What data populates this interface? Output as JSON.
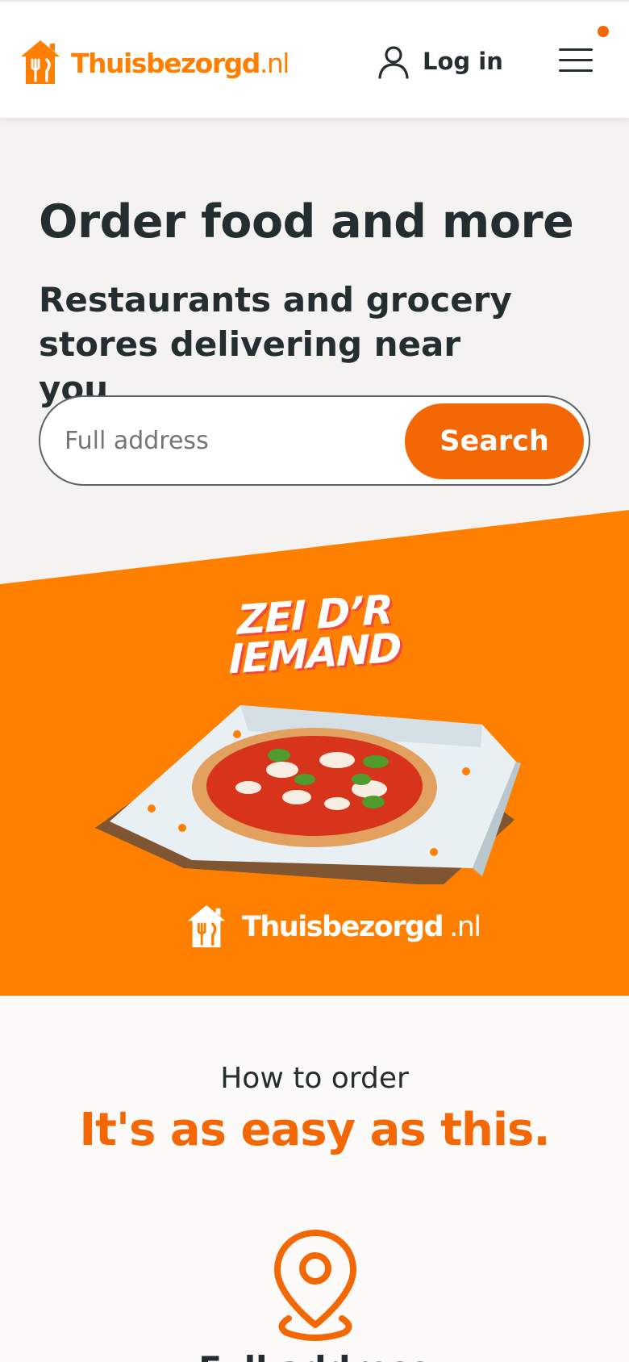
{
  "header": {
    "logo_text": "Thuisbezorgd",
    "logo_tld": ".nl",
    "login_label": "Log in",
    "login_icon": "user-icon",
    "menu_icon": "hamburger-menu-icon",
    "notification_indicator": "dot",
    "brand_color": "#ff8000"
  },
  "hero": {
    "title": "Order food and more",
    "subtitle": "Restaurants and grocery stores delivering near you",
    "search": {
      "placeholder": "Full address",
      "value": "",
      "button_label": "Search",
      "button_color": "#f36805"
    }
  },
  "promo": {
    "slogan_line1": "ZEI D’R",
    "slogan_line2": "IEMAND",
    "image": "pizza-in-box",
    "logo_text": "Thuisbezorgd",
    "logo_tld": ".nl",
    "background_color": "#ff8000"
  },
  "how_to_order": {
    "label": "How to order",
    "title": "It's as easy as this.",
    "first_step_icon": "location-pin-icon",
    "first_step_title": "Full address"
  }
}
